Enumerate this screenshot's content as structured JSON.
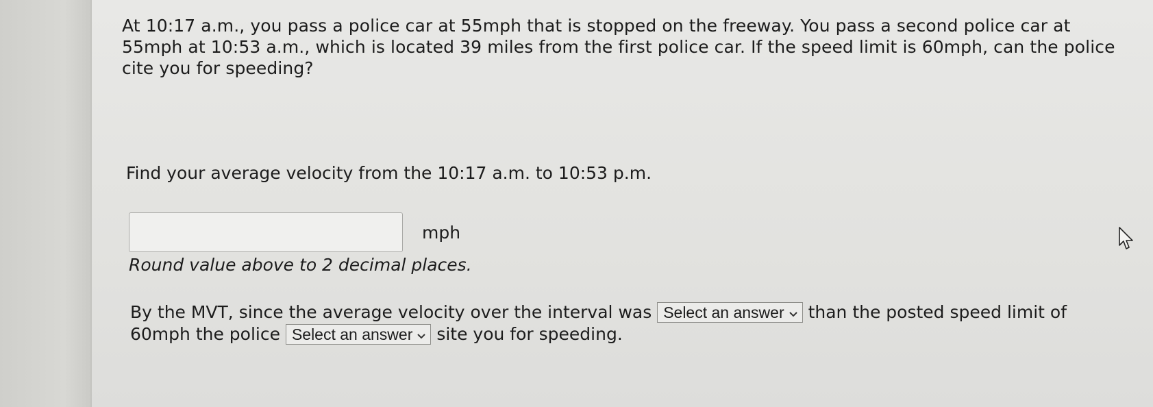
{
  "question": {
    "text": "At 10:17 a.m., you pass a police car at 55mph that is stopped on the freeway. You pass a second police car at 55mph at 10:53 a.m., which is located 39 miles from the first police car. If the speed limit is 60mph, can the police cite you for speeding?"
  },
  "part1": {
    "prompt": "Find your average velocity from the 10:17 a.m. to 10:53 p.m.",
    "input_value": "",
    "unit": "mph",
    "hint": "Round value above to 2 decimal places."
  },
  "part2": {
    "text_before": "By the MVT, since the average velocity over the interval was",
    "select1_label": "Select an answer",
    "text_middle": "than the posted speed limit of 60mph the police",
    "select2_label": "Select an answer",
    "text_after": "site you for speeding."
  },
  "icons": {
    "dropdown": "chevron-down-icon",
    "cursor": "mouse-pointer-icon"
  }
}
